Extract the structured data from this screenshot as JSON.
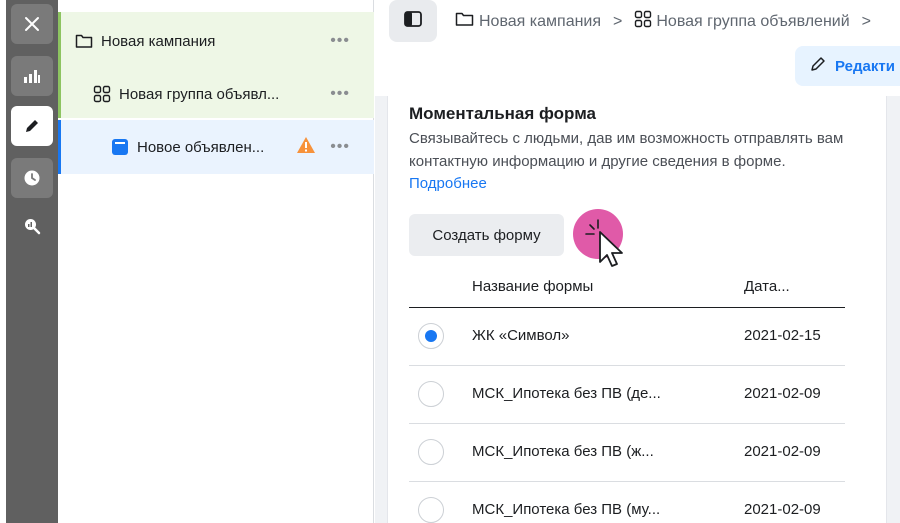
{
  "rail": {
    "items": [
      "close-icon",
      "chart-bars-icon",
      "pencil-icon",
      "clock-icon",
      "search-analytics-icon"
    ]
  },
  "tree": {
    "campaign": "Новая кампания",
    "ad_group": "Новая группа объявл...",
    "ad": "Новое объявлен...",
    "more": "•••"
  },
  "breadcrumb": {
    "campaign": "Новая кампания",
    "separator": ">",
    "ad_group": "Новая группа объявлений",
    "trailing_separator": ">"
  },
  "edit_button": "Редакти",
  "instant_form": {
    "title": "Моментальная форма",
    "description": "Связывайтесь с людьми, дав им возможность отправлять вам контактную информацию и другие сведения в форме.",
    "learn_more": "Подробнее",
    "create_button": "Создать форму"
  },
  "forms_table": {
    "headers": {
      "name": "Название формы",
      "date": "Дата..."
    },
    "rows": [
      {
        "name": "ЖК «Символ»",
        "date": "2021-02-15",
        "selected": true
      },
      {
        "name": "МСК_Ипотека без ПВ (де...",
        "date": "2021-02-09",
        "selected": false
      },
      {
        "name": "МСК_Ипотека без ПВ (ж...",
        "date": "2021-02-09",
        "selected": false
      },
      {
        "name": "МСК_Ипотека без ПВ (му...",
        "date": "2021-02-09",
        "selected": false
      }
    ]
  },
  "colors": {
    "accent": "#1877f2",
    "cursor_highlight": "#e05aa8",
    "warning": "#f7923b",
    "tree_green": "#eef7e6"
  }
}
